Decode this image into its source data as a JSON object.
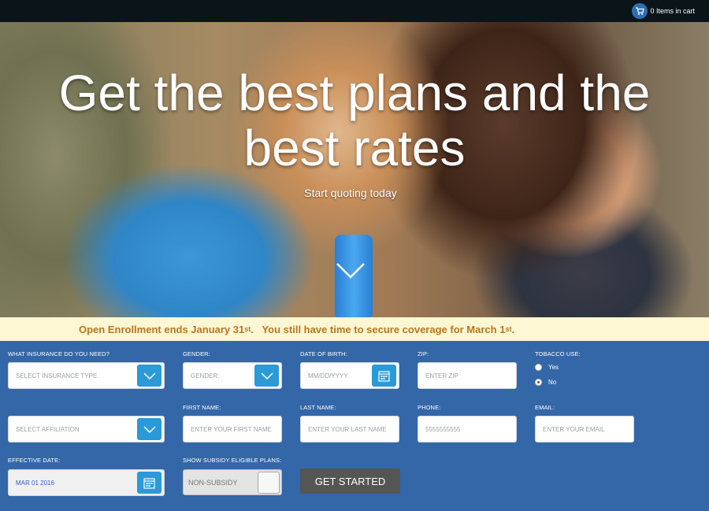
{
  "header": {
    "cart_text": "0 Items in cart",
    "cart_icon": "shopping-cart-icon"
  },
  "hero": {
    "title": "Get the best plans and the best rates",
    "subtitle": "Start quoting today",
    "scroll_icon": "chevron-down-icon"
  },
  "notice": {
    "part1": "Open Enrollment ends January 31",
    "sup1": "st",
    "part2": ".   You still have time to secure coverage for March 1",
    "sup2": "st",
    "part3": "."
  },
  "form": {
    "insurance_label": "WHAT INSURANCE DO YOU NEED?",
    "insurance_placeholder": "SELECT INSURANCE TYPE",
    "gender_label": "GENDER:",
    "gender_placeholder": "GENDER:",
    "dob_label": "DATE OF BIRTH:",
    "dob_placeholder": "MM/DD/YYYY",
    "zip_label": "ZIP:",
    "zip_placeholder": "ENTER ZIP",
    "tobacco_label": "TOBACCO USE:",
    "tobacco_options": [
      "Yes",
      "No"
    ],
    "tobacco_selected": "No",
    "affiliation_placeholder": "SELECT AFFILIATION",
    "first_name_label": "FIRST NAME:",
    "first_name_placeholder": "ENTER YOUR FIRST NAME",
    "last_name_label": "LAST NAME:",
    "last_name_placeholder": "ENTER YOUR LAST NAME",
    "phone_label": "PHONE:",
    "phone_placeholder": "5555555555",
    "email_label": "EMAIL:",
    "email_placeholder": "ENTER YOUR EMAIL",
    "effective_label": "EFFECTIVE DATE:",
    "effective_value": "MAR 01 2016",
    "subsidy_label": "SHOW SUBSIDY ELIGIBLE PLANS:",
    "subsidy_value": "NON-SUBSIDY",
    "submit_label": "GET STARTED"
  },
  "colors": {
    "form_bg": "#3467a8",
    "accent": "#2a9ad8",
    "notice_bg": "#fdf7d3",
    "notice_text": "#b8761e",
    "topbar": "#0b1419"
  }
}
